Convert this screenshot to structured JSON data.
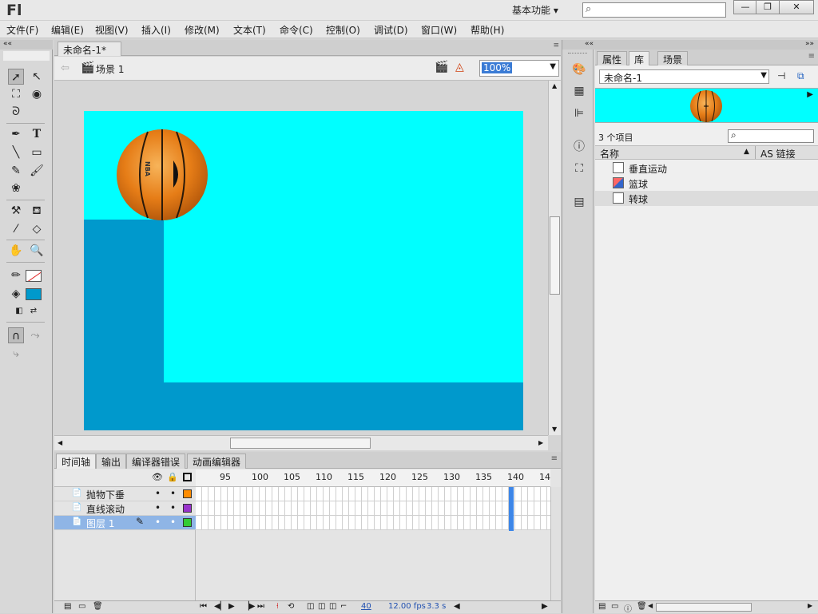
{
  "app": {
    "logo": "Fl",
    "workspace": "基本功能 ▾"
  },
  "window_controls": {
    "minimize": "—",
    "restore": "❐",
    "close": "✕"
  },
  "menus": [
    "文件(F)",
    "编辑(E)",
    "视图(V)",
    "插入(I)",
    "修改(M)",
    "文本(T)",
    "命令(C)",
    "控制(O)",
    "调试(D)",
    "窗口(W)",
    "帮助(H)"
  ],
  "document": {
    "tab_title": "未命名-1*",
    "tab_close": "×",
    "scene": "场景 1",
    "zoom": "100%"
  },
  "stage": {
    "background": "#00ffff",
    "shape_color": "#0099cc",
    "ball_text": "NBA"
  },
  "timeline": {
    "tabs": [
      "时间轴",
      "输出",
      "编译器错误",
      "动画编辑器"
    ],
    "ruler_ticks": [
      "95",
      "100",
      "105",
      "110",
      "115",
      "120",
      "125",
      "130",
      "135",
      "140",
      "14"
    ],
    "layers": [
      {
        "name": "抛物下垂",
        "color": "#ff8c00"
      },
      {
        "name": "直线滚动",
        "color": "#9933cc"
      },
      {
        "name": "图层 1",
        "color": "#33cc33"
      }
    ],
    "current_frame": "40",
    "fps": "12.00 fps",
    "time": "3.3 s"
  },
  "library": {
    "tabs": [
      "属性",
      "库",
      "场景"
    ],
    "document_select": "未命名-1",
    "item_count": "3 个项目",
    "col_name": "名称",
    "col_linkage": "AS 链接",
    "items": [
      "垂直运动",
      "篮球",
      "转球"
    ]
  }
}
